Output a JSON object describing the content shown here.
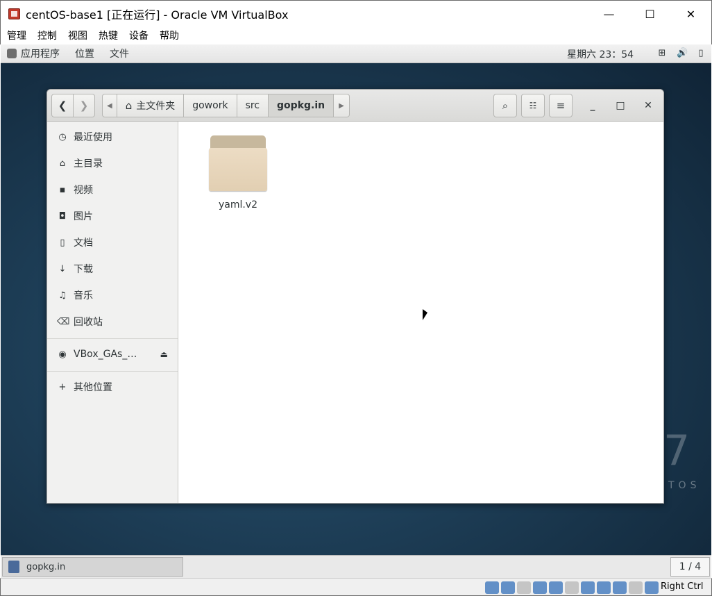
{
  "host": {
    "title": "centOS-base1 [正在运行] - Oracle VM VirtualBox",
    "controls": {
      "minimize": "—",
      "maximize": "☐",
      "close": "✕"
    },
    "menu": [
      "管理",
      "控制",
      "视图",
      "热键",
      "设备",
      "帮助"
    ],
    "host_key": "Right Ctrl"
  },
  "gnome": {
    "applications": "应用程序",
    "places": "位置",
    "files": "文件",
    "clock": "星期六 23：54",
    "watermark_number": "7",
    "watermark_text": "TOS"
  },
  "nautilus": {
    "path": [
      "主文件夹",
      "gowork",
      "src",
      "gopkg.in"
    ],
    "sidebar": [
      {
        "label": "最近使用",
        "icon": "clock-icon"
      },
      {
        "label": "主目录",
        "icon": "home-icon"
      },
      {
        "label": "视频",
        "icon": "video-icon"
      },
      {
        "label": "图片",
        "icon": "camera-icon"
      },
      {
        "label": "文档",
        "icon": "document-icon"
      },
      {
        "label": "下载",
        "icon": "download-icon"
      },
      {
        "label": "音乐",
        "icon": "music-icon"
      },
      {
        "label": "回收站",
        "icon": "trash-icon"
      }
    ],
    "device": "VBox_GAs_…",
    "other_locations": "其他位置",
    "files": [
      {
        "name": "yaml.v2",
        "type": "folder"
      }
    ]
  },
  "taskbar": {
    "window_label": "gopkg.in",
    "workspace": "1 / 4"
  }
}
